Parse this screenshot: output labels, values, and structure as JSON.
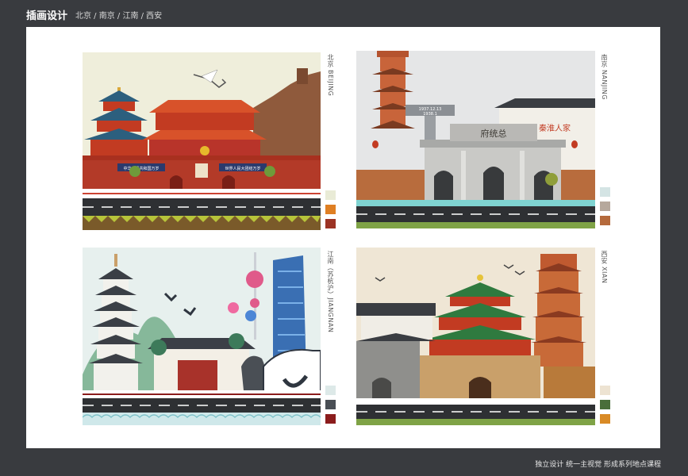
{
  "header": {
    "title": "插画设计",
    "subtitle": "北京 / 南京 / 江南 / 西安"
  },
  "panels": [
    {
      "label": "北京 BEIJING",
      "swatches": [
        "#e9ebd6",
        "#df7f23",
        "#9c3324"
      ],
      "sign_left": "中华人民共和国万岁",
      "sign_right": "世界人民大团结万岁"
    },
    {
      "label": "南京 NANJING",
      "swatches": [
        "#d4e4e4",
        "#b6a89c",
        "#b56a3c"
      ],
      "plaque": "府统总",
      "banner": "秦淮人家",
      "memorial_1": "1937.12.13",
      "memorial_2": "1938.1"
    },
    {
      "label": "江南（苏杭沪）JIANGNAN",
      "swatches": [
        "#dde9e8",
        "#4a4f55",
        "#8b1c1c"
      ]
    },
    {
      "label": "西安 XIAN",
      "swatches": [
        "#ede3d2",
        "#4a6e3a",
        "#d98a25"
      ]
    }
  ],
  "footer": "独立设计  统一主视觉  形成系列地点课程"
}
